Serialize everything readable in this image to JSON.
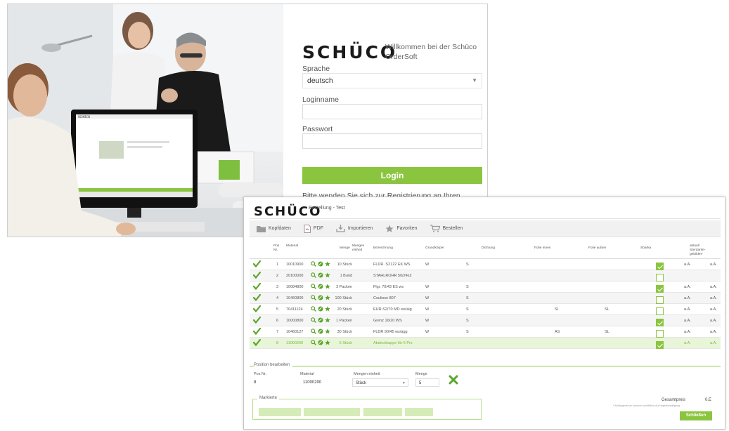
{
  "login": {
    "logo": "SCHÜCO",
    "welcome": "Willkommen bei der Schüco OrderSoft",
    "language_label": "Sprache",
    "language_value": "deutsch",
    "login_name_label": "Loginname",
    "password_label": "Passwort",
    "login_button": "Login",
    "registration_hint": "Bitte wenden Sie sich zur Registrierung an Ihren zuständigen Sachbearbeiter in Weissenfels."
  },
  "monitor": {
    "logo": "SCHÜCO"
  },
  "order": {
    "logo": "SCHÜCO",
    "title": "Bestellung - Test",
    "toolbar": [
      {
        "label": "Kopfdaten",
        "icon": "folder-icon"
      },
      {
        "label": "PDF",
        "icon": "pdf-icon"
      },
      {
        "label": "Importieren",
        "icon": "import-icon"
      },
      {
        "label": "Favoriten",
        "icon": "star-icon"
      },
      {
        "label": "Bestellen",
        "icon": "cart-icon"
      }
    ],
    "columns": {
      "pos": "Pos Nr.",
      "material": "Material",
      "menge": "Menge",
      "mengeneinheit": "Mengen einheit",
      "bezeichnung": "Bezeichnung",
      "grundkoerper": "Grundkörper",
      "dichtung": "Dichtung",
      "folie_innen": "Folie innen",
      "folie_aussen": "Folie außen",
      "sbarka": "Sbarka",
      "status": "aktuell Sterdanfe- gebildet*"
    },
    "rows": [
      {
        "pos": "1",
        "material": "10010900",
        "menge": "10 Stück",
        "bezeichnung": "FLDR. S2122 EK WS",
        "grund": "W",
        "dicht": "S",
        "fi": "",
        "fa": "",
        "checked": true,
        "a": "a.A.",
        "b": "a.A."
      },
      {
        "pos": "2",
        "material": "20100000",
        "menge": "1 Bund",
        "bezeichnung": "STAHLROHR 50/24x2",
        "grund": "",
        "dicht": "",
        "fi": "",
        "fa": "",
        "checked": false,
        "a": "",
        "b": ""
      },
      {
        "pos": "3",
        "material": "10084800",
        "menge": "3 Packen",
        "bezeichnung": "Flgr. 70/43 ES ws",
        "grund": "W",
        "dicht": "S",
        "fi": "",
        "fa": "",
        "checked": true,
        "a": "a.A.",
        "b": "a.A."
      },
      {
        "pos": "4",
        "material": "10460800",
        "menge": "100 Stück",
        "bezeichnung": "Coulisse 807",
        "grund": "W",
        "dicht": "S",
        "fi": "",
        "fa": "",
        "checked": false,
        "a": "a.A.",
        "b": "a.A."
      },
      {
        "pos": "5",
        "material": "70411124",
        "menge": "20 Stück",
        "bezeichnung": "EUR.S2/70 MD ws/aig",
        "grund": "W",
        "dicht": "S",
        "fi": "Sl",
        "fa": "SL",
        "checked": false,
        "a": "a.A.",
        "b": "a.A."
      },
      {
        "pos": "6",
        "material": "10000800",
        "menge": "1 Packen",
        "bezeichnung": "Grenz 16/20 WS",
        "grund": "W",
        "dicht": "S",
        "fi": "",
        "fa": "",
        "checked": true,
        "a": "a.A.",
        "b": "a.A."
      },
      {
        "pos": "7",
        "material": "10460127",
        "menge": "30 Stück",
        "bezeichnung": "FLDR 90/45 ws/agg",
        "grund": "W",
        "dicht": "S",
        "fi": "AS",
        "fa": "SL",
        "checked": false,
        "a": "a.A.",
        "b": "a.A."
      },
      {
        "pos": "8",
        "material": "11000200",
        "menge": "5 Stück",
        "bezeichnung": "Abdeckkappe für 5 Prs",
        "grund": "",
        "dicht": "",
        "fi": "",
        "fa": "",
        "checked": true,
        "a": "a.A.",
        "b": "a.A."
      }
    ],
    "edit": {
      "legend": "Position bearbeiten",
      "pos_label": "Pos Nr.",
      "pos_value": "8",
      "material_label": "Material",
      "material_value": "11000200",
      "unit_label": "Mengen einheit",
      "unit_value": "Stück",
      "qty_label": "Menge",
      "qty_value": "5"
    },
    "marker": {
      "legend": "Markierte"
    },
    "total": {
      "label": "Gesamtpreis",
      "value": "0.E",
      "note": "* Abhängenes an unseren schriftliche Auft eigenbestätigung"
    },
    "submit_button": "Schließen"
  },
  "colors": {
    "accent": "#8bc53f",
    "accent_light": "#e9f5d8"
  }
}
